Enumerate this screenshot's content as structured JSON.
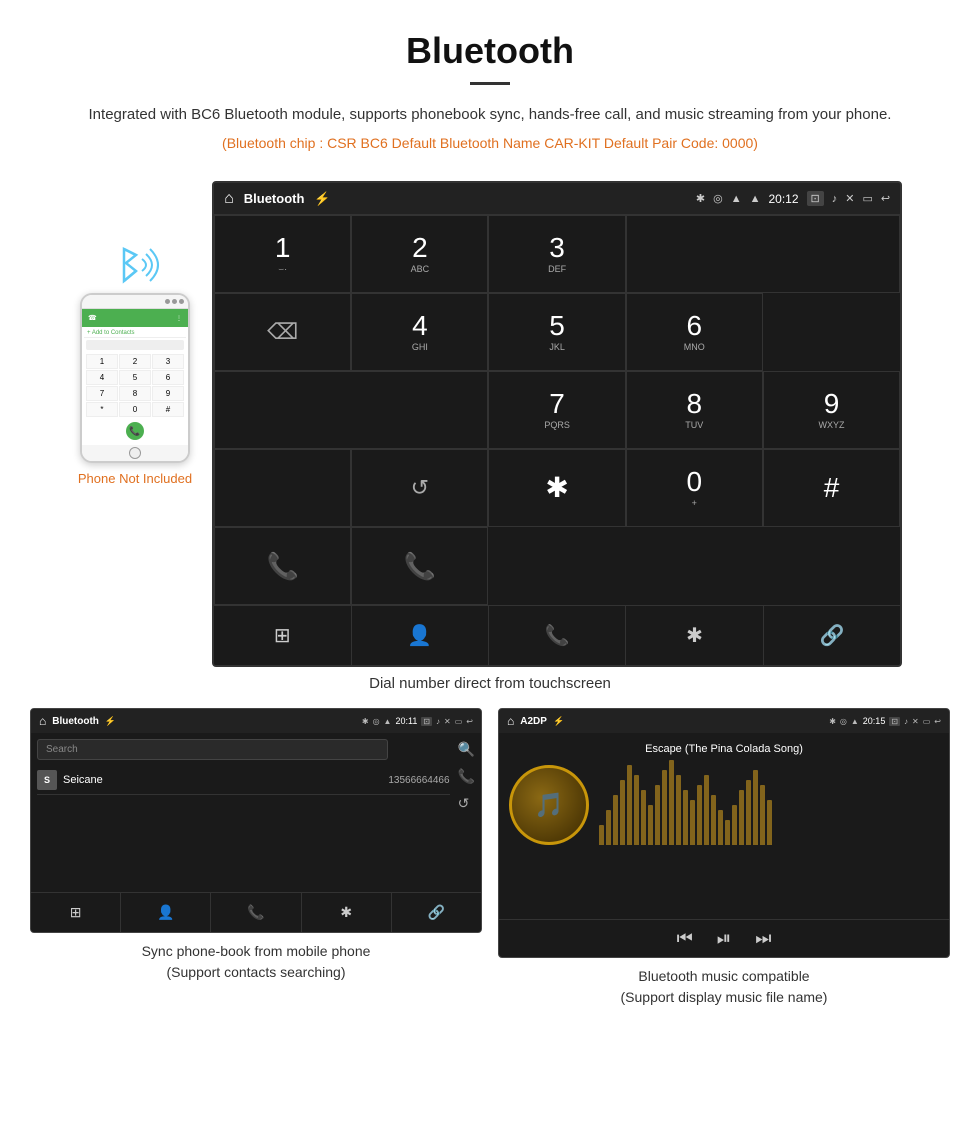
{
  "header": {
    "title": "Bluetooth",
    "description": "Integrated with BC6 Bluetooth module, supports phonebook sync, hands-free call, and music streaming from your phone.",
    "specs": "(Bluetooth chip : CSR BC6    Default Bluetooth Name CAR-KIT    Default Pair Code: 0000)"
  },
  "phone_label": "Phone Not Included",
  "main_dial": {
    "statusbar": {
      "home": "⌂",
      "title": "Bluetooth",
      "usb": "⚡",
      "bluetooth": "✱",
      "location": "◎",
      "wifi": "▲",
      "time": "20:12",
      "camera": "⊡",
      "volume": "♪",
      "close": "✕",
      "rect": "▭",
      "back": "↩"
    },
    "keys": [
      {
        "main": "1",
        "sub": "⌣·"
      },
      {
        "main": "2",
        "sub": "ABC"
      },
      {
        "main": "3",
        "sub": "DEF"
      },
      {
        "main": "",
        "sub": ""
      },
      {
        "main": "⌫",
        "sub": "",
        "special": "backspace"
      },
      {
        "main": "4",
        "sub": "GHI"
      },
      {
        "main": "5",
        "sub": "JKL"
      },
      {
        "main": "6",
        "sub": "MNO"
      },
      {
        "main": "",
        "sub": "",
        "special": "display"
      },
      {
        "main": "",
        "sub": "",
        "special": "display"
      },
      {
        "main": "7",
        "sub": "PQRS"
      },
      {
        "main": "8",
        "sub": "TUV"
      },
      {
        "main": "9",
        "sub": "WXYZ"
      },
      {
        "main": "",
        "sub": "",
        "special": "display"
      },
      {
        "main": "↺",
        "sub": "",
        "special": "refresh"
      },
      {
        "main": "✱",
        "sub": ""
      },
      {
        "main": "0",
        "sub": "+"
      },
      {
        "main": "#",
        "sub": ""
      },
      {
        "main": "📞",
        "sub": "",
        "special": "call-green"
      },
      {
        "main": "📞",
        "sub": "",
        "special": "call-red"
      }
    ],
    "nav": [
      "⊞",
      "👤",
      "📞",
      "✱",
      "🔗"
    ]
  },
  "dial_caption": "Dial number direct from touchscreen",
  "phonebook_screen": {
    "statusbar_title": "Bluetooth",
    "time": "20:11",
    "search_placeholder": "Search",
    "contacts": [
      {
        "initial": "S",
        "name": "Seicane",
        "number": "13566664466"
      }
    ],
    "nav": [
      "⊞",
      "👤",
      "📞",
      "✱",
      "🔗"
    ]
  },
  "phonebook_caption_line1": "Sync phone-book from mobile phone",
  "phonebook_caption_line2": "(Support contacts searching)",
  "music_screen": {
    "statusbar_title": "A2DP",
    "time": "20:15",
    "song_title": "Escape (The Pina Colada Song)",
    "controls": [
      "⏮",
      "⏯",
      "⏭"
    ]
  },
  "music_caption_line1": "Bluetooth music compatible",
  "music_caption_line2": "(Support display music file name)",
  "viz_bars": [
    20,
    35,
    50,
    65,
    80,
    70,
    55,
    40,
    60,
    75,
    85,
    70,
    55,
    45,
    60,
    70,
    50,
    35,
    25,
    40,
    55,
    65,
    75,
    60,
    45
  ]
}
